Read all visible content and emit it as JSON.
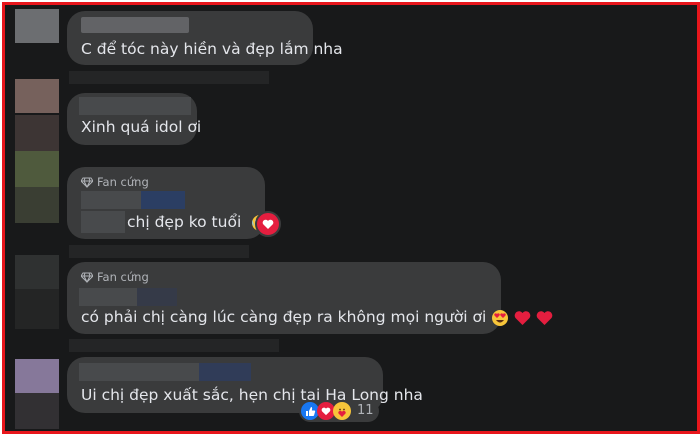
{
  "comments": [
    {
      "text": "C để tóc này hiền và đẹp lắm nha"
    },
    {
      "text": "Xinh quá idol ơi"
    },
    {
      "badge": "Fan cứng",
      "text": "chị đẹp ko tuổi"
    },
    {
      "badge": "Fan cứng",
      "text": "có phải chị càng lúc càng đẹp ra không mọi người ơi"
    },
    {
      "text": "Ui chị đẹp xuất sắc, hẹn chị tại Hạ Long nha",
      "reaction_count": "11"
    }
  ],
  "colors": {
    "frame_border": "#e8161c",
    "background": "#18191a",
    "bubble": "#3a3b3c",
    "text": "#e4e6eb",
    "heart": "#e41e3f",
    "like": "#1877f2"
  },
  "icons": [
    "diamond-icon",
    "astonished-emoji-icon",
    "heart-reaction-icon",
    "heart-eyes-emoji-icon",
    "red-heart-emoji-icon",
    "like-reaction-icon",
    "care-reaction-icon"
  ]
}
